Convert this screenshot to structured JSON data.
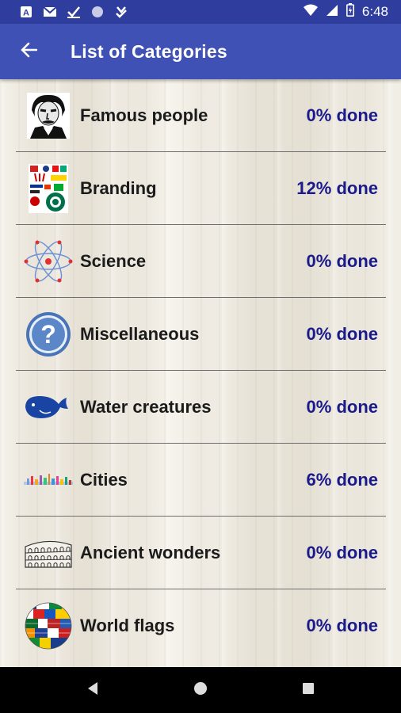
{
  "status_bar": {
    "time": "6:48",
    "icons": [
      "a-notification-icon",
      "mail-icon",
      "check-icon",
      "circle-icon",
      "download-done-icon"
    ],
    "right_icons": [
      "wifi-icon",
      "signal-icon",
      "battery-icon"
    ]
  },
  "app_bar": {
    "title": "List of Categories",
    "back_icon": "arrow-left-icon"
  },
  "categories": [
    {
      "label": "Famous people",
      "progress": "0% done",
      "icon": "portrait-icon"
    },
    {
      "label": "Branding",
      "progress": "12% done",
      "icon": "logos-collage-icon"
    },
    {
      "label": "Science",
      "progress": "0% done",
      "icon": "atom-icon"
    },
    {
      "label": "Miscellaneous",
      "progress": "0% done",
      "icon": "question-mark-icon"
    },
    {
      "label": "Water creatures",
      "progress": "0% done",
      "icon": "whale-icon"
    },
    {
      "label": "Cities",
      "progress": "6% done",
      "icon": "skyline-icon"
    },
    {
      "label": "Ancient wonders",
      "progress": "0% done",
      "icon": "colosseum-icon"
    },
    {
      "label": "World flags",
      "progress": "0% done",
      "icon": "flags-globe-icon"
    }
  ],
  "colors": {
    "status_bar": "#2f3e9e",
    "app_bar": "#3f51b5",
    "progress_text": "#1a1a8c"
  },
  "nav_bar": {
    "icons": [
      "back-triangle-icon",
      "home-circle-icon",
      "recents-square-icon"
    ]
  }
}
